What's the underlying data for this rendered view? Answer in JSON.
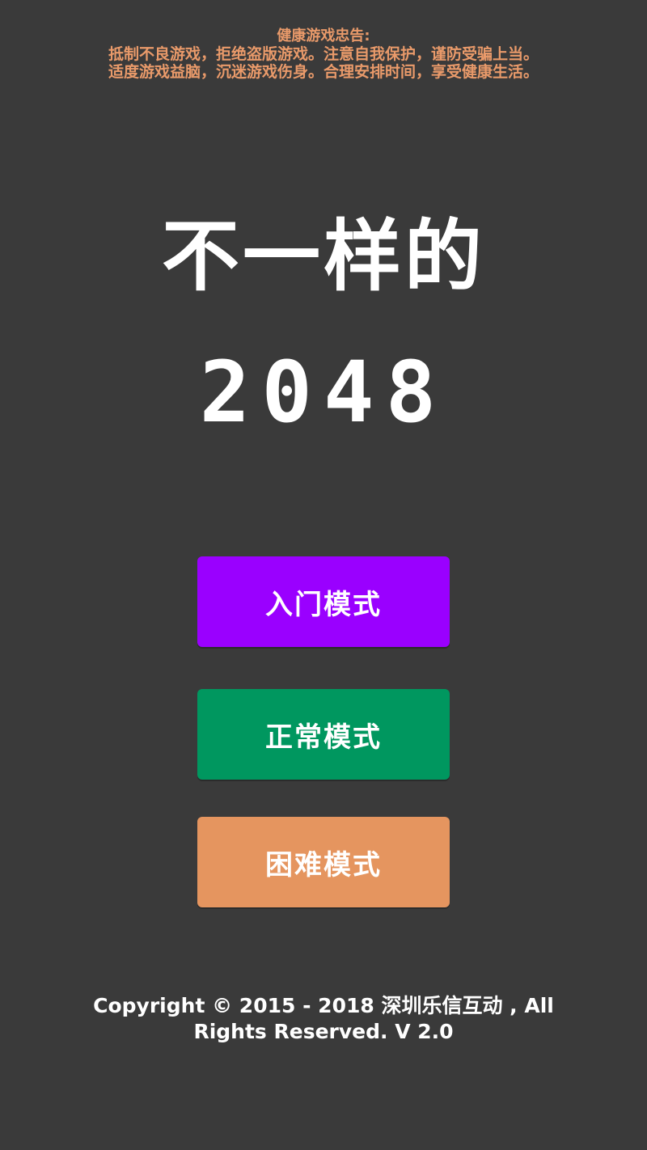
{
  "advisory": {
    "title": "健康游戏忠告:",
    "line1": "抵制不良游戏，拒绝盗版游戏。注意自我保护，谨防受骗上当。",
    "line2": "适度游戏益脑，沉迷游戏伤身。合理安排时间，享受健康生活。"
  },
  "title": {
    "line1": "不一样的",
    "line2": "2048"
  },
  "modes": {
    "easy_label": "入门模式",
    "normal_label": "正常模式",
    "hard_label": "困难模式"
  },
  "footer": {
    "line1": "Copyright © 2015 - 2018 深圳乐信互动 , All",
    "line2": "Rights Reserved. V 2.0"
  },
  "colors": {
    "background": "#3a3a3a",
    "advisory_text": "#e99a6a",
    "easy_button": "#9a00ff",
    "normal_button": "#00975f",
    "hard_button": "#e5955f"
  }
}
